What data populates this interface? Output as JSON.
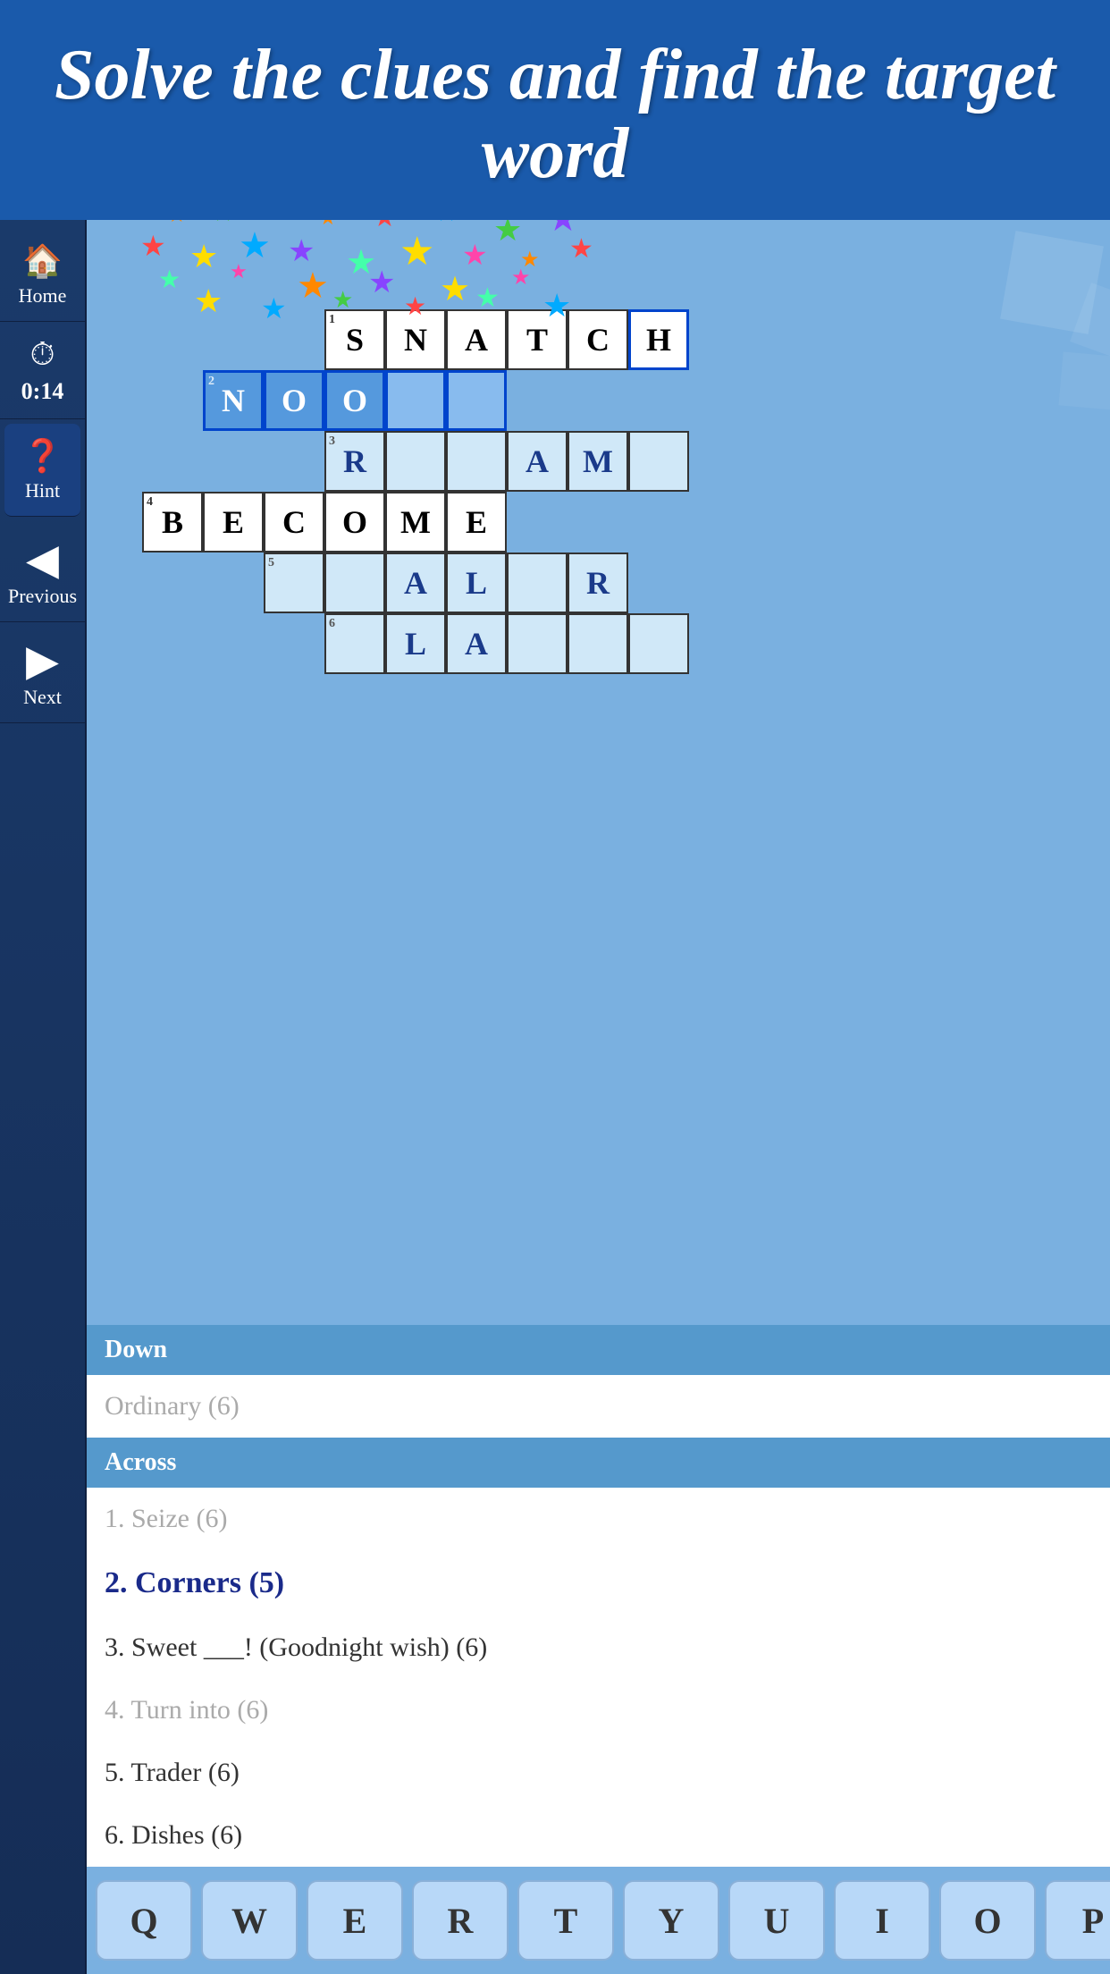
{
  "header": {
    "title": "Solve the clues and find the target word"
  },
  "sidebar": {
    "home_label": "Home",
    "timer_label": "0:14",
    "hint_label": "Hint",
    "previous_label": "Previous",
    "next_label": "Next"
  },
  "grid": {
    "rows": [
      {
        "clue_num": 1,
        "word": "SNATCH",
        "row": 0,
        "col_start": 2
      },
      {
        "clue_num": 2,
        "word": "NOO__",
        "row": 1,
        "col_start": 0
      },
      {
        "clue_num": 3,
        "partial": "R__AM_",
        "row": 2,
        "col_start": 2
      },
      {
        "clue_num": 4,
        "word": "BECOME",
        "row": 3,
        "col_start": -1
      },
      {
        "clue_num": 5,
        "partial": "__AL_R",
        "row": 4,
        "col_start": 1
      },
      {
        "clue_num": 6,
        "partial": "_LA__",
        "row": 5,
        "col_start": 2
      }
    ]
  },
  "clues": {
    "down_header": "Down",
    "down_items": [
      {
        "text": "Ordinary (6)",
        "completed": true
      }
    ],
    "across_header": "Across",
    "across_items": [
      {
        "num": "1.",
        "text": "Seize (6)",
        "completed": true
      },
      {
        "num": "2.",
        "text": "Corners (5)",
        "active": true
      },
      {
        "num": "3.",
        "text": "Sweet ___! (Goodnight wish) (6)",
        "completed": false
      },
      {
        "num": "4.",
        "text": "Turn into (6)",
        "completed": true
      },
      {
        "num": "5.",
        "text": "Trader (6)",
        "completed": false
      },
      {
        "num": "6.",
        "text": "Dishes (6)",
        "completed": false
      }
    ]
  },
  "keyboard": {
    "keys": [
      "Q",
      "W",
      "E",
      "R",
      "T",
      "Y",
      "U",
      "I",
      "O",
      "P"
    ]
  }
}
